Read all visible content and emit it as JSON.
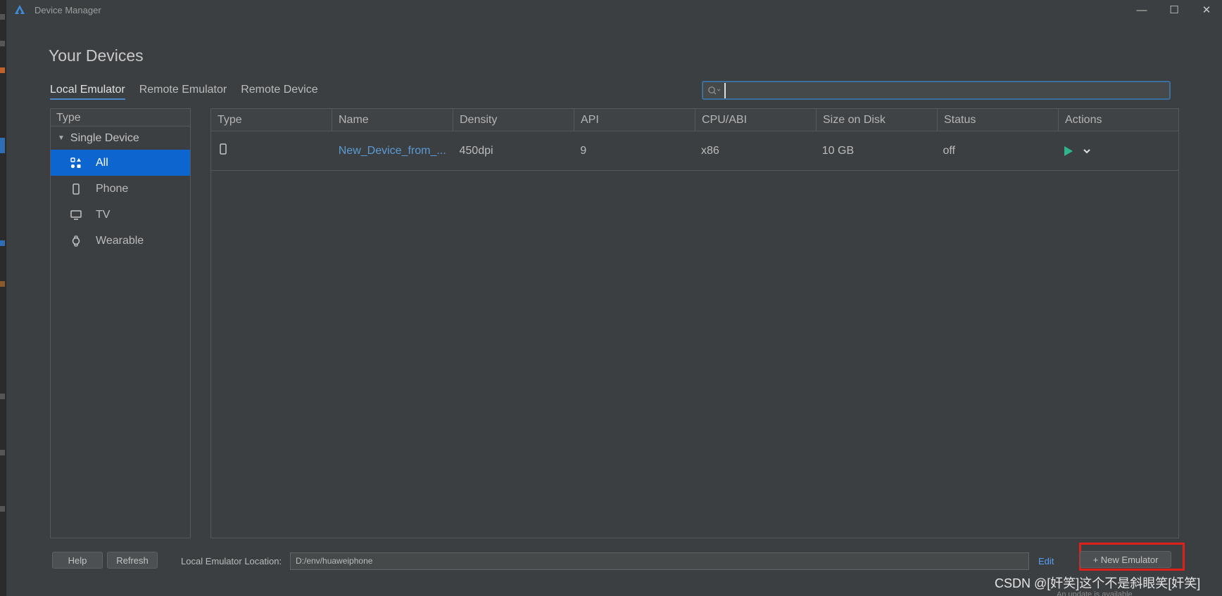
{
  "window": {
    "title": "Device Manager",
    "minimize_glyph": "—",
    "maximize_glyph": "☐",
    "close_glyph": "✕"
  },
  "page_title": "Your Devices",
  "tabs": [
    {
      "label": "Local Emulator",
      "active": true
    },
    {
      "label": "Remote Emulator",
      "active": false
    },
    {
      "label": "Remote Device",
      "active": false
    }
  ],
  "search": {
    "value": "",
    "placeholder": ""
  },
  "type_panel": {
    "header": "Type",
    "group": "Single Device",
    "items": [
      {
        "label": "All",
        "icon": "grid-icon",
        "selected": true
      },
      {
        "label": "Phone",
        "icon": "phone-icon",
        "selected": false
      },
      {
        "label": "TV",
        "icon": "tv-icon",
        "selected": false
      },
      {
        "label": "Wearable",
        "icon": "watch-icon",
        "selected": false
      }
    ]
  },
  "table": {
    "columns": [
      "Type",
      "Name",
      "Density",
      "API",
      "CPU/ABI",
      "Size on Disk",
      "Status",
      "Actions"
    ],
    "rows": [
      {
        "type_icon": "phone-icon",
        "name": "New_Device_from_...",
        "density": "450dpi",
        "api": "9",
        "cpu": "x86",
        "size": "10 GB",
        "status": "off"
      }
    ]
  },
  "bottom": {
    "help_label": "Help",
    "refresh_label": "Refresh",
    "location_label": "Local Emulator Location:",
    "location_value": "D:/env/huaweiphone",
    "edit_label": "Edit",
    "new_emulator_label": "+ New Emulator"
  },
  "watermark": "CSDN @[奸笑]这个不是斜眼笑[奸笑]",
  "update_note": "An update is available",
  "colors": {
    "accent": "#0d66d0",
    "link": "#589df6",
    "play": "#2fb58a",
    "highlight": "#e0201c"
  }
}
